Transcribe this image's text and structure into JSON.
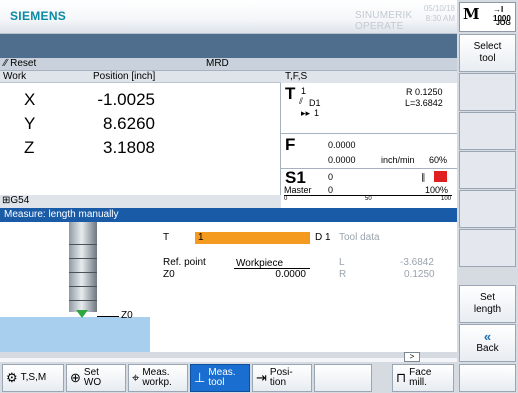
{
  "header": {
    "logo": "SIEMENS",
    "brand": "SINUMERIK OPERATE",
    "date": "05/10/18",
    "time": "8:30 AM",
    "mode_icon": "M",
    "mode_arrow": "→I 1000",
    "mode_label": "JOG"
  },
  "status": {
    "reset": "Reset",
    "program": "MRD"
  },
  "positions": {
    "col_work": "Work",
    "col_position": "Position [inch]",
    "rows": [
      {
        "axis": "X",
        "value": "-1.0025"
      },
      {
        "axis": "Y",
        "value": "8.6260"
      },
      {
        "axis": "Z",
        "value": "3.1808"
      }
    ],
    "offset": "G54"
  },
  "tfs": {
    "header": "T,F,S",
    "t_letter": "T",
    "tool_num": "1",
    "d_label": "D1",
    "next_tool": "1",
    "r_value": "R 0.1250",
    "l_value": "L=3.6842",
    "f_letter": "F",
    "f_set": "0.0000",
    "f_actual": "0.0000",
    "f_unit": "inch/min",
    "f_override": "60%",
    "s_letter": "S1",
    "s_set": "0",
    "s_mode": "Master",
    "s_actual": "0",
    "s_override": "100%",
    "s_scale_mid": "50",
    "s_scale_max": "100",
    "s_scale_min": "0"
  },
  "measure": {
    "title": "Measure: length manually",
    "t_label": "T",
    "t_value": "1",
    "d_value": "D 1",
    "tool_data_label": "Tool data",
    "ref_label": "Ref. point",
    "ref_value": "Workpiece",
    "z0_label": "Z0",
    "z0_value": "0.0000",
    "l_label": "L",
    "l_value": "-3.6842",
    "r_label": "R",
    "r_value": "0.1250",
    "graphic_z0": "Z0"
  },
  "vertical_softkeys": {
    "select_tool": "Select tool",
    "set_length": "Set length",
    "back": "Back"
  },
  "horizontal_softkeys": [
    {
      "label": "T,S,M",
      "icon": "tool-spindle-icon"
    },
    {
      "label": "Set WO",
      "icon": "work-offset-icon"
    },
    {
      "label": "Meas. workp.",
      "icon": "measure-workpiece-icon"
    },
    {
      "label": "Meas. tool",
      "icon": "measure-tool-icon"
    },
    {
      "label": "Posi- tion",
      "icon": "position-icon"
    },
    {
      "label": "Face mill.",
      "icon": "face-mill-icon"
    }
  ],
  "colors": {
    "title_bar": "#1a5ba8",
    "field_active": "#f59a21",
    "softkey_active": "#1a6ed0",
    "workpiece": "#a9cfee",
    "spindle_stop": "#e02020"
  }
}
